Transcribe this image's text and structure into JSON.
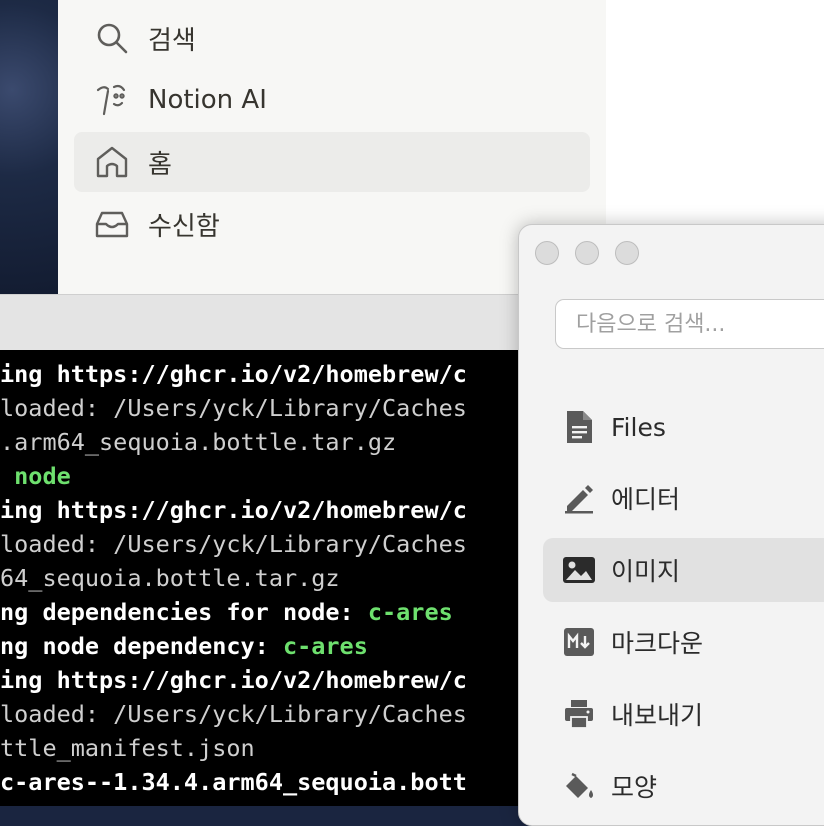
{
  "notion_sidebar": {
    "items": [
      {
        "label": "검색",
        "icon": "search-icon"
      },
      {
        "label": "Notion AI",
        "icon": "notion-ai-icon"
      },
      {
        "label": "홈",
        "icon": "home-icon",
        "active": true
      },
      {
        "label": "수신함",
        "icon": "inbox-icon"
      }
    ]
  },
  "terminal": {
    "lines": [
      [
        {
          "t": "ing https://ghcr.io/v2/homebrew/c",
          "c": "white"
        }
      ],
      [
        {
          "t": "loaded: /Users/yck/Library/Caches",
          "c": "gray"
        }
      ],
      [
        {
          "t": ".arm64_sequoia.bottle.tar.gz",
          "c": "gray"
        }
      ],
      [
        {
          "t": " node",
          "c": "green"
        }
      ],
      [
        {
          "t": "ing https://ghcr.io/v2/homebrew/c",
          "c": "white"
        }
      ],
      [
        {
          "t": "loaded: /Users/yck/Library/Caches",
          "c": "gray"
        }
      ],
      [
        {
          "t": "64_sequoia.bottle.tar.gz",
          "c": "gray"
        }
      ],
      [
        {
          "t": "ng dependencies for node: ",
          "c": "white"
        },
        {
          "t": "c-ares",
          "c": "green"
        }
      ],
      [
        {
          "t": "ng node dependency: ",
          "c": "white"
        },
        {
          "t": "c-ares",
          "c": "green"
        }
      ],
      [
        {
          "t": "ing https://ghcr.io/v2/homebrew/c",
          "c": "white"
        }
      ],
      [
        {
          "t": "loaded: /Users/yck/Library/Caches",
          "c": "gray"
        }
      ],
      [
        {
          "t": "ttle_manifest.json",
          "c": "gray"
        }
      ],
      [
        {
          "t": "c-ares--1.34.4.arm64_sequoia.bott",
          "c": "white"
        }
      ]
    ]
  },
  "panel": {
    "search_placeholder": "다음으로 검색...",
    "items": [
      {
        "label": "Files",
        "icon": "file-icon"
      },
      {
        "label": "에디터",
        "icon": "pencil-icon"
      },
      {
        "label": "이미지",
        "icon": "image-icon",
        "active": true
      },
      {
        "label": "마크다운",
        "icon": "markdown-icon"
      },
      {
        "label": "내보내기",
        "icon": "printer-icon"
      },
      {
        "label": "모양",
        "icon": "paint-bucket-icon"
      }
    ]
  },
  "colors": {
    "terminal_green": "#6ee06e",
    "notion_active_bg": "#ececea",
    "panel_active_bg": "#e1e1e1"
  }
}
